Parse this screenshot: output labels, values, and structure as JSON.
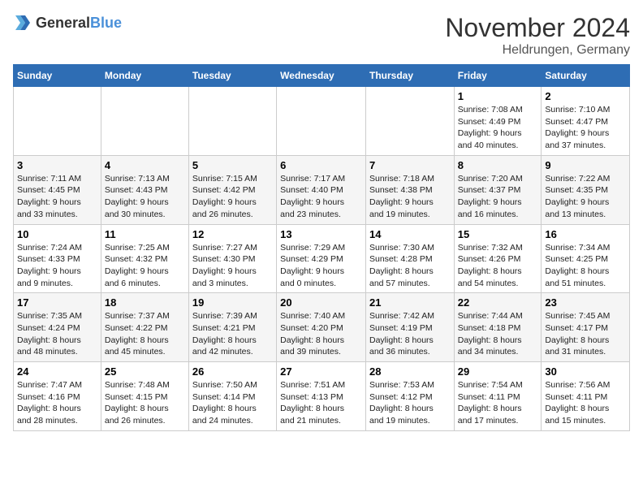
{
  "header": {
    "logo_general": "General",
    "logo_blue": "Blue",
    "month_title": "November 2024",
    "location": "Heldrungen, Germany"
  },
  "days_of_week": [
    "Sunday",
    "Monday",
    "Tuesday",
    "Wednesday",
    "Thursday",
    "Friday",
    "Saturday"
  ],
  "weeks": [
    [
      {
        "day": "",
        "detail": ""
      },
      {
        "day": "",
        "detail": ""
      },
      {
        "day": "",
        "detail": ""
      },
      {
        "day": "",
        "detail": ""
      },
      {
        "day": "",
        "detail": ""
      },
      {
        "day": "1",
        "detail": "Sunrise: 7:08 AM\nSunset: 4:49 PM\nDaylight: 9 hours\nand 40 minutes."
      },
      {
        "day": "2",
        "detail": "Sunrise: 7:10 AM\nSunset: 4:47 PM\nDaylight: 9 hours\nand 37 minutes."
      }
    ],
    [
      {
        "day": "3",
        "detail": "Sunrise: 7:11 AM\nSunset: 4:45 PM\nDaylight: 9 hours\nand 33 minutes."
      },
      {
        "day": "4",
        "detail": "Sunrise: 7:13 AM\nSunset: 4:43 PM\nDaylight: 9 hours\nand 30 minutes."
      },
      {
        "day": "5",
        "detail": "Sunrise: 7:15 AM\nSunset: 4:42 PM\nDaylight: 9 hours\nand 26 minutes."
      },
      {
        "day": "6",
        "detail": "Sunrise: 7:17 AM\nSunset: 4:40 PM\nDaylight: 9 hours\nand 23 minutes."
      },
      {
        "day": "7",
        "detail": "Sunrise: 7:18 AM\nSunset: 4:38 PM\nDaylight: 9 hours\nand 19 minutes."
      },
      {
        "day": "8",
        "detail": "Sunrise: 7:20 AM\nSunset: 4:37 PM\nDaylight: 9 hours\nand 16 minutes."
      },
      {
        "day": "9",
        "detail": "Sunrise: 7:22 AM\nSunset: 4:35 PM\nDaylight: 9 hours\nand 13 minutes."
      }
    ],
    [
      {
        "day": "10",
        "detail": "Sunrise: 7:24 AM\nSunset: 4:33 PM\nDaylight: 9 hours\nand 9 minutes."
      },
      {
        "day": "11",
        "detail": "Sunrise: 7:25 AM\nSunset: 4:32 PM\nDaylight: 9 hours\nand 6 minutes."
      },
      {
        "day": "12",
        "detail": "Sunrise: 7:27 AM\nSunset: 4:30 PM\nDaylight: 9 hours\nand 3 minutes."
      },
      {
        "day": "13",
        "detail": "Sunrise: 7:29 AM\nSunset: 4:29 PM\nDaylight: 9 hours\nand 0 minutes."
      },
      {
        "day": "14",
        "detail": "Sunrise: 7:30 AM\nSunset: 4:28 PM\nDaylight: 8 hours\nand 57 minutes."
      },
      {
        "day": "15",
        "detail": "Sunrise: 7:32 AM\nSunset: 4:26 PM\nDaylight: 8 hours\nand 54 minutes."
      },
      {
        "day": "16",
        "detail": "Sunrise: 7:34 AM\nSunset: 4:25 PM\nDaylight: 8 hours\nand 51 minutes."
      }
    ],
    [
      {
        "day": "17",
        "detail": "Sunrise: 7:35 AM\nSunset: 4:24 PM\nDaylight: 8 hours\nand 48 minutes."
      },
      {
        "day": "18",
        "detail": "Sunrise: 7:37 AM\nSunset: 4:22 PM\nDaylight: 8 hours\nand 45 minutes."
      },
      {
        "day": "19",
        "detail": "Sunrise: 7:39 AM\nSunset: 4:21 PM\nDaylight: 8 hours\nand 42 minutes."
      },
      {
        "day": "20",
        "detail": "Sunrise: 7:40 AM\nSunset: 4:20 PM\nDaylight: 8 hours\nand 39 minutes."
      },
      {
        "day": "21",
        "detail": "Sunrise: 7:42 AM\nSunset: 4:19 PM\nDaylight: 8 hours\nand 36 minutes."
      },
      {
        "day": "22",
        "detail": "Sunrise: 7:44 AM\nSunset: 4:18 PM\nDaylight: 8 hours\nand 34 minutes."
      },
      {
        "day": "23",
        "detail": "Sunrise: 7:45 AM\nSunset: 4:17 PM\nDaylight: 8 hours\nand 31 minutes."
      }
    ],
    [
      {
        "day": "24",
        "detail": "Sunrise: 7:47 AM\nSunset: 4:16 PM\nDaylight: 8 hours\nand 28 minutes."
      },
      {
        "day": "25",
        "detail": "Sunrise: 7:48 AM\nSunset: 4:15 PM\nDaylight: 8 hours\nand 26 minutes."
      },
      {
        "day": "26",
        "detail": "Sunrise: 7:50 AM\nSunset: 4:14 PM\nDaylight: 8 hours\nand 24 minutes."
      },
      {
        "day": "27",
        "detail": "Sunrise: 7:51 AM\nSunset: 4:13 PM\nDaylight: 8 hours\nand 21 minutes."
      },
      {
        "day": "28",
        "detail": "Sunrise: 7:53 AM\nSunset: 4:12 PM\nDaylight: 8 hours\nand 19 minutes."
      },
      {
        "day": "29",
        "detail": "Sunrise: 7:54 AM\nSunset: 4:11 PM\nDaylight: 8 hours\nand 17 minutes."
      },
      {
        "day": "30",
        "detail": "Sunrise: 7:56 AM\nSunset: 4:11 PM\nDaylight: 8 hours\nand 15 minutes."
      }
    ]
  ]
}
